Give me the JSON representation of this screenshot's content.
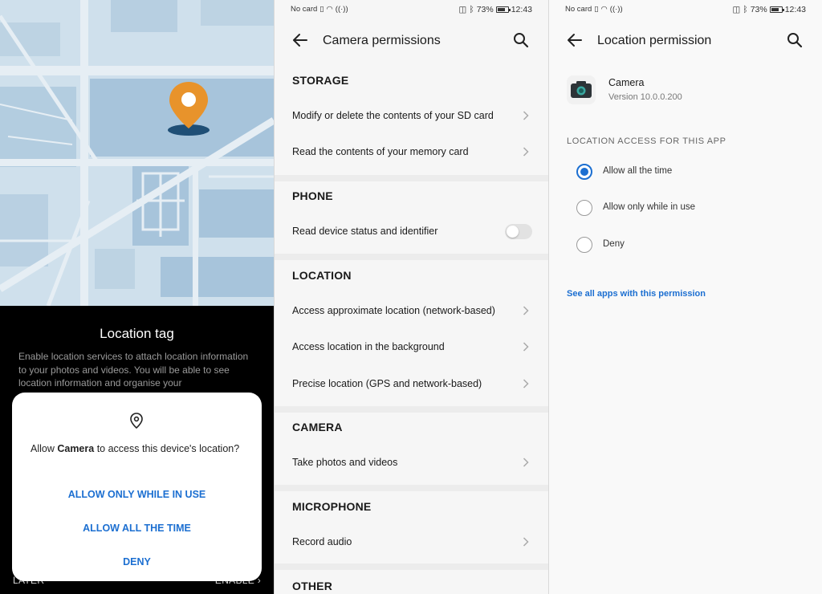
{
  "screen1": {
    "title": "Location tag",
    "description": "Enable location services to attach location information to your photos and videos. You will be able to see location information and organise your",
    "later": "LATER",
    "enable": "ENABLE",
    "dialog": {
      "msg_prefix": "Allow ",
      "msg_app": "Camera",
      "msg_suffix": " to access this device's location?",
      "btn_while_in_use": "ALLOW ONLY WHILE IN USE",
      "btn_all_time": "ALLOW ALL THE TIME",
      "btn_deny": "DENY"
    },
    "colors": {
      "pin": "#e8932b",
      "pin_shadow": "#1f4f76",
      "map_bg": "#cfe0ec"
    }
  },
  "status": {
    "no_card": "No card",
    "battery": "73%",
    "time": "12:43"
  },
  "screen2": {
    "title": "Camera permissions",
    "sections": {
      "storage": "STORAGE",
      "phone": "PHONE",
      "location": "LOCATION",
      "camera": "CAMERA",
      "microphone": "MICROPHONE",
      "other": "OTHER"
    },
    "items": {
      "sd_modify": "Modify or delete the contents of your SD card",
      "memory_read": "Read the contents of your memory card",
      "device_status": "Read device status and identifier",
      "approx_location": "Access approximate location (network-based)",
      "background_location": "Access location in the background",
      "precise_location": "Precise location (GPS and network-based)",
      "take_photos": "Take photos and videos",
      "record_audio": "Record audio"
    },
    "device_status_enabled": false
  },
  "screen3": {
    "title": "Location permission",
    "app_name": "Camera",
    "app_version": "Version 10.0.0.200",
    "subheader": "LOCATION ACCESS FOR THIS APP",
    "options": [
      "Allow all the time",
      "Allow only while in use",
      "Deny"
    ],
    "selected_option": "Allow all the time",
    "link": "See all apps with this permission",
    "accent": "#1c6fd1"
  }
}
